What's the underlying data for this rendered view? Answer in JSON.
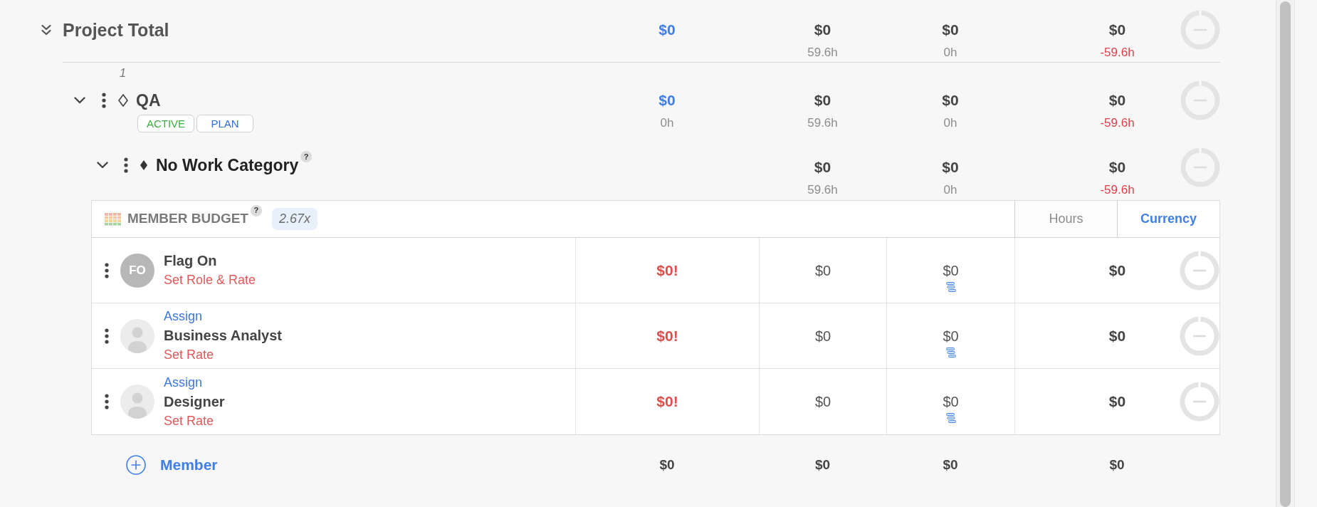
{
  "project_total": {
    "title": "Project Total",
    "expanded": true,
    "cells": {
      "column_1": {
        "kind": "budget",
        "amount": "$0"
      },
      "column_2": {
        "kind": "plain",
        "amount": "$0",
        "hours": "59.6h"
      },
      "column_3": {
        "kind": "plain",
        "amount": "$0",
        "hours": "0h"
      },
      "column_4": {
        "kind": "variance",
        "amount": "$0",
        "hours": "-59.6h"
      }
    }
  },
  "phases": [
    {
      "number": "1",
      "title": "QA",
      "expanded": true,
      "badges": [
        {
          "label": "ACTIVE",
          "color": "#3cae3f"
        },
        {
          "label": "PLAN",
          "color": "#2f6fd8"
        }
      ],
      "cells": {
        "column_1": {
          "kind": "budget",
          "amount": "$0",
          "hours": "0h"
        },
        "column_2": {
          "kind": "plain",
          "amount": "$0",
          "hours": "59.6h"
        },
        "column_3": {
          "kind": "plain",
          "amount": "$0",
          "hours": "0h"
        },
        "column_4": {
          "kind": "variance",
          "amount": "$0",
          "hours": "-59.6h"
        }
      },
      "work_categories": [
        {
          "title": "No Work Category",
          "help_mark": "?",
          "expanded": true,
          "cells": {
            "column_2": {
              "kind": "plain",
              "amount": "$0",
              "hours": "59.6h"
            },
            "column_3": {
              "kind": "plain",
              "amount": "$0",
              "hours": "0h"
            },
            "column_4": {
              "kind": "variance",
              "amount": "$0",
              "hours": "-59.6h"
            }
          },
          "member_budget": {
            "title": "MEMBER BUDGET",
            "help_mark": "?",
            "multiplier": "2.67x",
            "unit_toggle": [
              {
                "label": "Hours",
                "selected": false
              },
              {
                "label": "Currency",
                "selected": true
              }
            ],
            "members": [
              {
                "kind": "person",
                "initials": "FO",
                "name": "Flag On",
                "rate_action": "Set Role & Rate",
                "cells": [
                  {
                    "amount": "$0!",
                    "warning": true
                  },
                  {
                    "amount": "$0",
                    "warning": false
                  },
                  {
                    "amount": "$0",
                    "warning": false
                  },
                  {
                    "amount": "$0",
                    "warning": false
                  }
                ]
              },
              {
                "kind": "role",
                "assign_action": "Assign",
                "name": "Business Analyst",
                "rate_action": "Set Rate",
                "cells": [
                  {
                    "amount": "$0!",
                    "warning": true
                  },
                  {
                    "amount": "$0",
                    "warning": false
                  },
                  {
                    "amount": "$0",
                    "warning": false
                  },
                  {
                    "amount": "$0",
                    "warning": false
                  }
                ]
              },
              {
                "kind": "role",
                "assign_action": "Assign",
                "name": "Designer",
                "rate_action": "Set Rate",
                "cells": [
                  {
                    "amount": "$0!",
                    "warning": true
                  },
                  {
                    "amount": "$0",
                    "warning": false
                  },
                  {
                    "amount": "$0",
                    "warning": false
                  },
                  {
                    "amount": "$0",
                    "warning": false
                  }
                ]
              }
            ],
            "add_member_label": "Member",
            "totals": [
              "$0",
              "$0",
              "$0",
              "$0"
            ]
          }
        }
      ]
    }
  ]
}
